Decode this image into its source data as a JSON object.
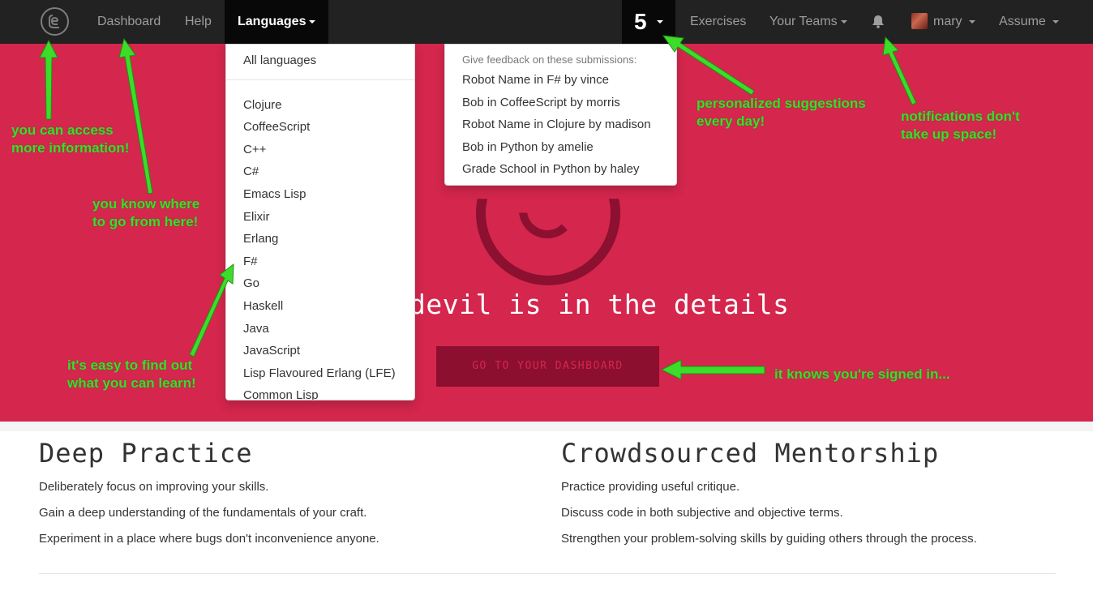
{
  "navbar": {
    "dashboard": "Dashboard",
    "help": "Help",
    "languages": "Languages",
    "suggestion_count": "5",
    "exercises": "Exercises",
    "your_teams": "Your Teams",
    "user": "mary",
    "assume": "Assume"
  },
  "languages_menu": {
    "all": "All languages",
    "items": [
      "Clojure",
      "CoffeeScript",
      "C++",
      "C#",
      "Emacs Lisp",
      "Elixir",
      "Erlang",
      "F#",
      "Go",
      "Haskell",
      "Java",
      "JavaScript",
      "Lisp Flavoured Erlang (LFE)",
      "Common Lisp"
    ]
  },
  "suggestions_menu": {
    "header": "Give feedback on these submissions:",
    "items": [
      "Robot Name in F# by vince",
      "Bob in CoffeeScript by morris",
      "Robot Name in Clojure by madison",
      "Bob in Python by amelie",
      "Grade School in Python by haley"
    ]
  },
  "hero": {
    "tagline": "devil is in the details",
    "cta": "GO TO YOUR DASHBOARD",
    "background_color": "#d5264d"
  },
  "features": {
    "left": {
      "title": "Deep Practice",
      "lines": [
        "Deliberately focus on improving your skills.",
        "Gain a deep understanding of the fundamentals of your craft.",
        "Experiment in a place where bugs don't inconvenience anyone."
      ]
    },
    "right": {
      "title": "Crowdsourced Mentorship",
      "lines": [
        "Practice providing useful critique.",
        "Discuss code in both subjective and objective terms.",
        "Strengthen your problem-solving skills by guiding others through the process."
      ]
    }
  },
  "annotations": {
    "logo": [
      "you can access",
      "more information!"
    ],
    "dashboard": [
      "you know where",
      "to go from here!"
    ],
    "languages": [
      "it's easy to find out",
      "what you can learn!"
    ],
    "suggestions": [
      "personalized suggestions",
      "every day!"
    ],
    "notifications": [
      "notifications don't",
      "take up space!"
    ],
    "signed_in": "it knows you're signed in..."
  },
  "icons": {
    "logo": "exercism-logo-icon",
    "bell": "bell-icon",
    "avatar": "user-avatar"
  },
  "colors": {
    "navbar": "#222222",
    "annotation": "#3ddc2b",
    "cta_background": "#8c0f30"
  }
}
